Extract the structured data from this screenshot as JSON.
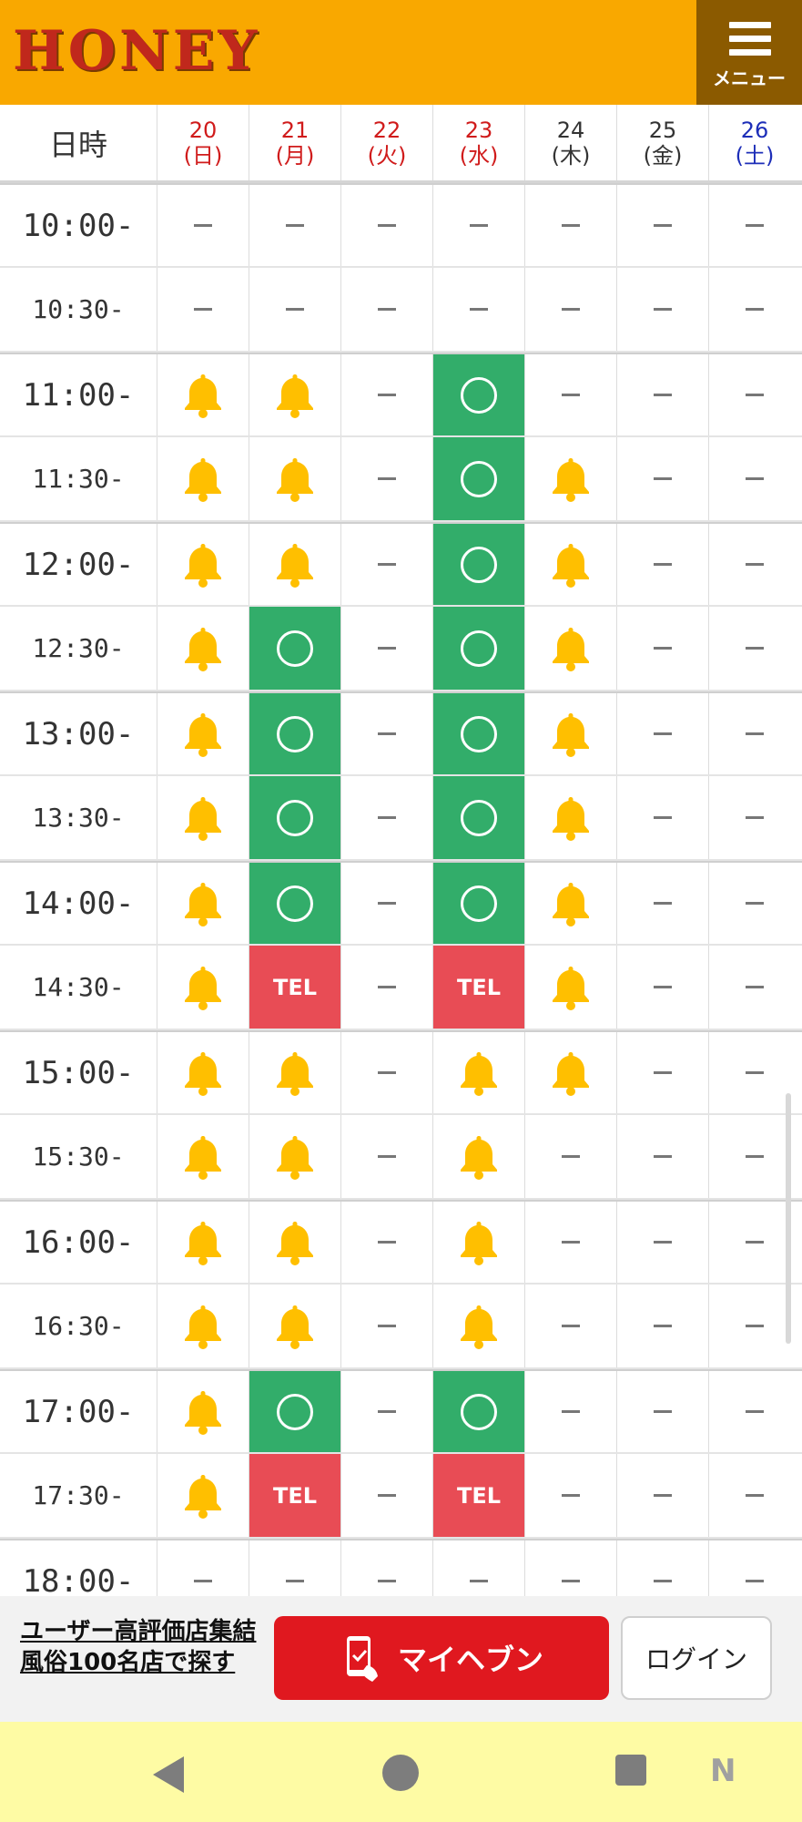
{
  "header": {
    "logo_text": "HONEY",
    "menu_label": "メニュー"
  },
  "table": {
    "time_header": "日時",
    "days": [
      {
        "date": "20",
        "dow": "(日)",
        "color": "#d01b1b"
      },
      {
        "date": "21",
        "dow": "(月)",
        "color": "#d01b1b"
      },
      {
        "date": "22",
        "dow": "(火)",
        "color": "#d01b1b"
      },
      {
        "date": "23",
        "dow": "(水)",
        "color": "#d01b1b"
      },
      {
        "date": "24",
        "dow": "(木)",
        "color": "#333333"
      },
      {
        "date": "25",
        "dow": "(金)",
        "color": "#333333"
      },
      {
        "date": "26",
        "dow": "(土)",
        "color": "#1d2eb8"
      }
    ],
    "rows": [
      {
        "time": "10:00-",
        "slots": [
          "-",
          "-",
          "-",
          "-",
          "-",
          "-",
          "-"
        ]
      },
      {
        "time": "10:30-",
        "slots": [
          "-",
          "-",
          "-",
          "-",
          "-",
          "-",
          "-"
        ]
      },
      {
        "time": "11:00-",
        "slots": [
          "bell",
          "bell",
          "-",
          "open",
          "-",
          "-",
          "-"
        ]
      },
      {
        "time": "11:30-",
        "slots": [
          "bell",
          "bell",
          "-",
          "open",
          "bell",
          "-",
          "-"
        ]
      },
      {
        "time": "12:00-",
        "slots": [
          "bell",
          "bell",
          "-",
          "open",
          "bell",
          "-",
          "-"
        ]
      },
      {
        "time": "12:30-",
        "slots": [
          "bell",
          "open",
          "-",
          "open",
          "bell",
          "-",
          "-"
        ]
      },
      {
        "time": "13:00-",
        "slots": [
          "bell",
          "open",
          "-",
          "open",
          "bell",
          "-",
          "-"
        ]
      },
      {
        "time": "13:30-",
        "slots": [
          "bell",
          "open",
          "-",
          "open",
          "bell",
          "-",
          "-"
        ]
      },
      {
        "time": "14:00-",
        "slots": [
          "bell",
          "open",
          "-",
          "open",
          "bell",
          "-",
          "-"
        ]
      },
      {
        "time": "14:30-",
        "slots": [
          "bell",
          "TEL",
          "-",
          "TEL",
          "bell",
          "-",
          "-"
        ]
      },
      {
        "time": "15:00-",
        "slots": [
          "bell",
          "bell",
          "-",
          "bell",
          "bell",
          "-",
          "-"
        ]
      },
      {
        "time": "15:30-",
        "slots": [
          "bell",
          "bell",
          "-",
          "bell",
          "-",
          "-",
          "-"
        ]
      },
      {
        "time": "16:00-",
        "slots": [
          "bell",
          "bell",
          "-",
          "bell",
          "-",
          "-",
          "-"
        ]
      },
      {
        "time": "16:30-",
        "slots": [
          "bell",
          "bell",
          "-",
          "bell",
          "-",
          "-",
          "-"
        ]
      },
      {
        "time": "17:00-",
        "slots": [
          "bell",
          "open",
          "-",
          "open",
          "-",
          "-",
          "-"
        ]
      },
      {
        "time": "17:30-",
        "slots": [
          "bell",
          "TEL",
          "-",
          "TEL",
          "-",
          "-",
          "-"
        ]
      },
      {
        "time": "18:00-",
        "slots": [
          "-",
          "-",
          "-",
          "-",
          "-",
          "-",
          "-"
        ]
      }
    ],
    "colors": {
      "open": "#32ad6a",
      "tel": "#e84c55",
      "bell": "#ffbf00"
    }
  },
  "bottom_bar": {
    "link_line1": "ユーザー高評価店集結",
    "link_line2": "風俗100名店で探す",
    "myheaven_label": "マイヘブン",
    "login_label": "ログイン"
  },
  "nav": {
    "back_icon": "back-triangle-icon",
    "home_icon": "home-circle-icon",
    "recent_icon": "recent-square-icon",
    "corner_mark": "N"
  }
}
